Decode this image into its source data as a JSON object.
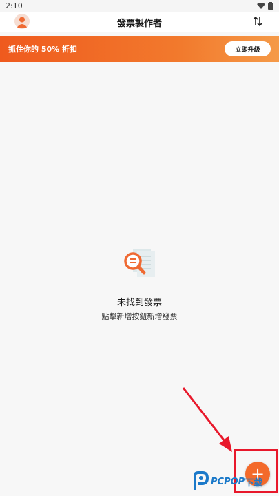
{
  "status_bar": {
    "time": "2:10"
  },
  "app_bar": {
    "title": "發票製作者"
  },
  "promo": {
    "text": "抓住你的 50% 折扣",
    "button_label": "立即升級"
  },
  "empty_state": {
    "title": "未找到發票",
    "subtitle": "點擊新增按鈕新增發票"
  },
  "fab": {
    "label": "+"
  },
  "watermark": {
    "brand": "PCPOP",
    "suffix": "下载"
  },
  "colors": {
    "accent": "#f36a2b",
    "promo_start": "#ef5a1e",
    "highlight": "#e8182b"
  }
}
